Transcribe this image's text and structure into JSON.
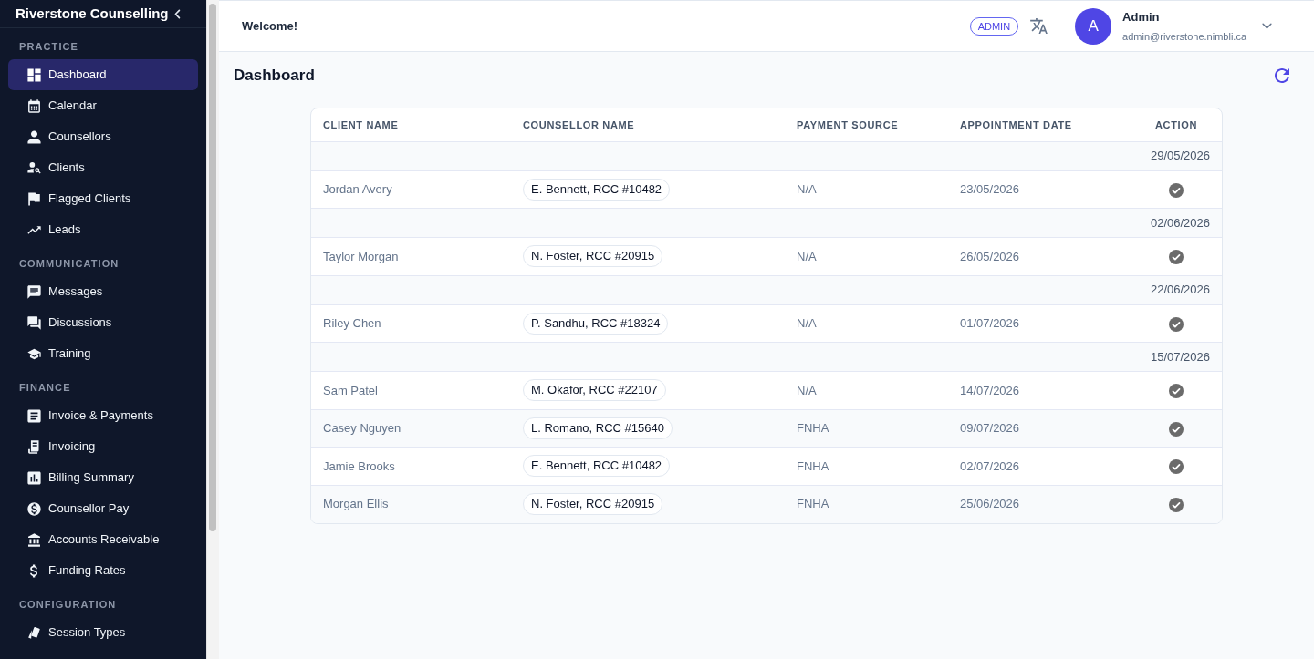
{
  "sidebar": {
    "title": "Riverstone Counselling",
    "sections": [
      {
        "heading": "PRACTICE",
        "items": [
          {
            "label": "Dashboard",
            "selected": true
          },
          {
            "label": "Calendar",
            "selected": false
          },
          {
            "label": "Counsellors",
            "selected": false
          },
          {
            "label": "Clients",
            "selected": false
          },
          {
            "label": "Flagged Clients",
            "selected": false
          },
          {
            "label": "Leads",
            "selected": false
          }
        ]
      },
      {
        "heading": "COMMUNICATION",
        "items": [
          {
            "label": "Messages",
            "selected": false
          },
          {
            "label": "Discussions",
            "selected": false
          },
          {
            "label": "Training",
            "selected": false
          }
        ]
      },
      {
        "heading": "FINANCE",
        "items": [
          {
            "label": "Invoice & Payments",
            "selected": false
          },
          {
            "label": "Invoicing",
            "selected": false
          },
          {
            "label": "Billing Summary",
            "selected": false
          },
          {
            "label": "Counsellor Pay",
            "selected": false
          },
          {
            "label": "Accounts Receivable",
            "selected": false
          },
          {
            "label": "Funding Rates",
            "selected": false
          }
        ]
      },
      {
        "heading": "CONFIGURATION",
        "items": [
          {
            "label": "Session Types",
            "selected": false
          }
        ]
      }
    ]
  },
  "top_bar": {
    "greeting": "Welcome!",
    "role_badge": "ADMIN",
    "user": {
      "avatar_letter": "A",
      "name": "Admin",
      "email": "admin@riverstone.nimbli.ca"
    }
  },
  "page": {
    "title": "Dashboard"
  },
  "table": {
    "columns": [
      "CLIENT NAME",
      "COUNSELLOR NAME",
      "PAYMENT SOURCE",
      "APPOINTMENT DATE",
      "ACTION"
    ],
    "groups": [
      {
        "date": "29/05/2026",
        "rows": [
          {
            "client": "Jordan Avery",
            "counsellor": "E. Bennett, RCC #10482",
            "payment_source": "N/A",
            "appointment_date": "23/05/2026"
          }
        ]
      },
      {
        "date": "02/06/2026",
        "rows": [
          {
            "client": "Taylor Morgan",
            "counsellor": "N. Foster, RCC #20915",
            "payment_source": "N/A",
            "appointment_date": "26/05/2026"
          }
        ]
      },
      {
        "date": "22/06/2026",
        "rows": [
          {
            "client": "Riley Chen",
            "counsellor": "P. Sandhu, RCC #18324",
            "payment_source": "N/A",
            "appointment_date": "01/07/2026"
          }
        ]
      },
      {
        "date": "15/07/2026",
        "rows": [
          {
            "client": "Sam Patel",
            "counsellor": "M. Okafor, RCC #22107",
            "payment_source": "N/A",
            "appointment_date": "14/07/2026"
          },
          {
            "client": "Casey Nguyen",
            "counsellor": "L. Romano, RCC #15640",
            "payment_source": "FNHA",
            "appointment_date": "09/07/2026"
          },
          {
            "client": "Jamie Brooks",
            "counsellor": "E. Bennett, RCC #10482",
            "payment_source": "FNHA",
            "appointment_date": "02/07/2026"
          },
          {
            "client": "Morgan Ellis",
            "counsellor": "N. Foster, RCC #20915",
            "payment_source": "FNHA",
            "appointment_date": "25/06/2026"
          }
        ]
      }
    ]
  }
}
